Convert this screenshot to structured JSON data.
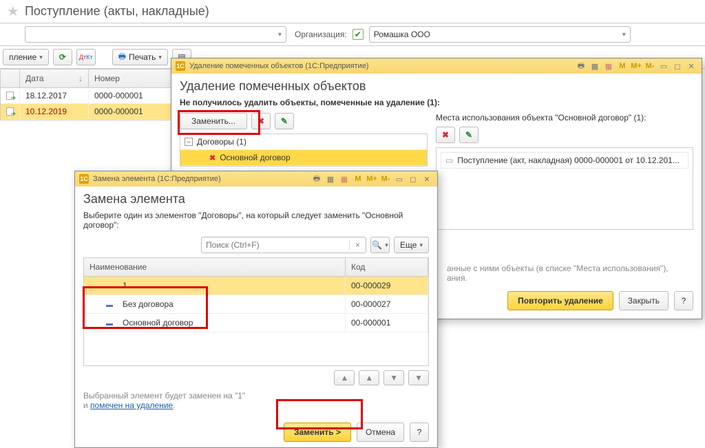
{
  "header": {
    "title": "Поступление (акты, накладные)"
  },
  "filter": {
    "org_label": "Организация:",
    "org_value": "Ромашка ООО"
  },
  "toolbar": {
    "update_label": "пление",
    "print_label": "Печать"
  },
  "grid": {
    "col_date": "Дата",
    "col_number": "Номер",
    "rows": [
      {
        "date": "18.12.2017",
        "number": "0000-000001",
        "selected": false
      },
      {
        "date": "10.12.2019",
        "number": "0000-000001",
        "selected": true
      }
    ]
  },
  "del_dialog": {
    "titlebar": "Удаление помеченных объектов (1С:Предприятие)",
    "heading": "Удаление помеченных объектов",
    "subheading": "Не получилось удалить объекты, помеченные на удаление (1):",
    "replace_btn": "Заменить...",
    "tree_group": "Договоры (1)",
    "tree_item": "Основной договор",
    "usage_label": "Места использования объекта \"Основной договор\" (1):",
    "usage_item": "Поступление (акт, накладная) 0000-000001 от 10.12.201...",
    "hint_tail": "анные с ними объекты (в списке \"Места использования\"),\nания.",
    "repeat_btn": "Повторить удаление",
    "close_btn": "Закрыть",
    "help_btn": "?"
  },
  "replace_dialog": {
    "titlebar": "Замена элемента  (1С:Предприятие)",
    "heading": "Замена элемента",
    "instruction": "Выберите один из элементов \"Договоры\", на который следует заменить \"Основной договор\":",
    "search_placeholder": "Поиск (Ctrl+F)",
    "more_btn": "Еще",
    "col_name": "Наименование",
    "col_code": "Код",
    "rows": [
      {
        "name": "1",
        "code": "00-000029",
        "selected": true
      },
      {
        "name": "Без договора",
        "code": "00-000027",
        "selected": false
      },
      {
        "name": "Основной договор",
        "code": "00-000001",
        "selected": false
      }
    ],
    "footer_text_1": "Выбранный элемент будет заменен на \"1\"",
    "footer_text_2": "и ",
    "footer_link": "помечен на удаление",
    "replace_btn": "Заменить >",
    "cancel_btn": "Отмена",
    "help_btn": "?"
  },
  "mem_labels": {
    "m": "M",
    "mplus": "M+",
    "mminus": "M-"
  }
}
